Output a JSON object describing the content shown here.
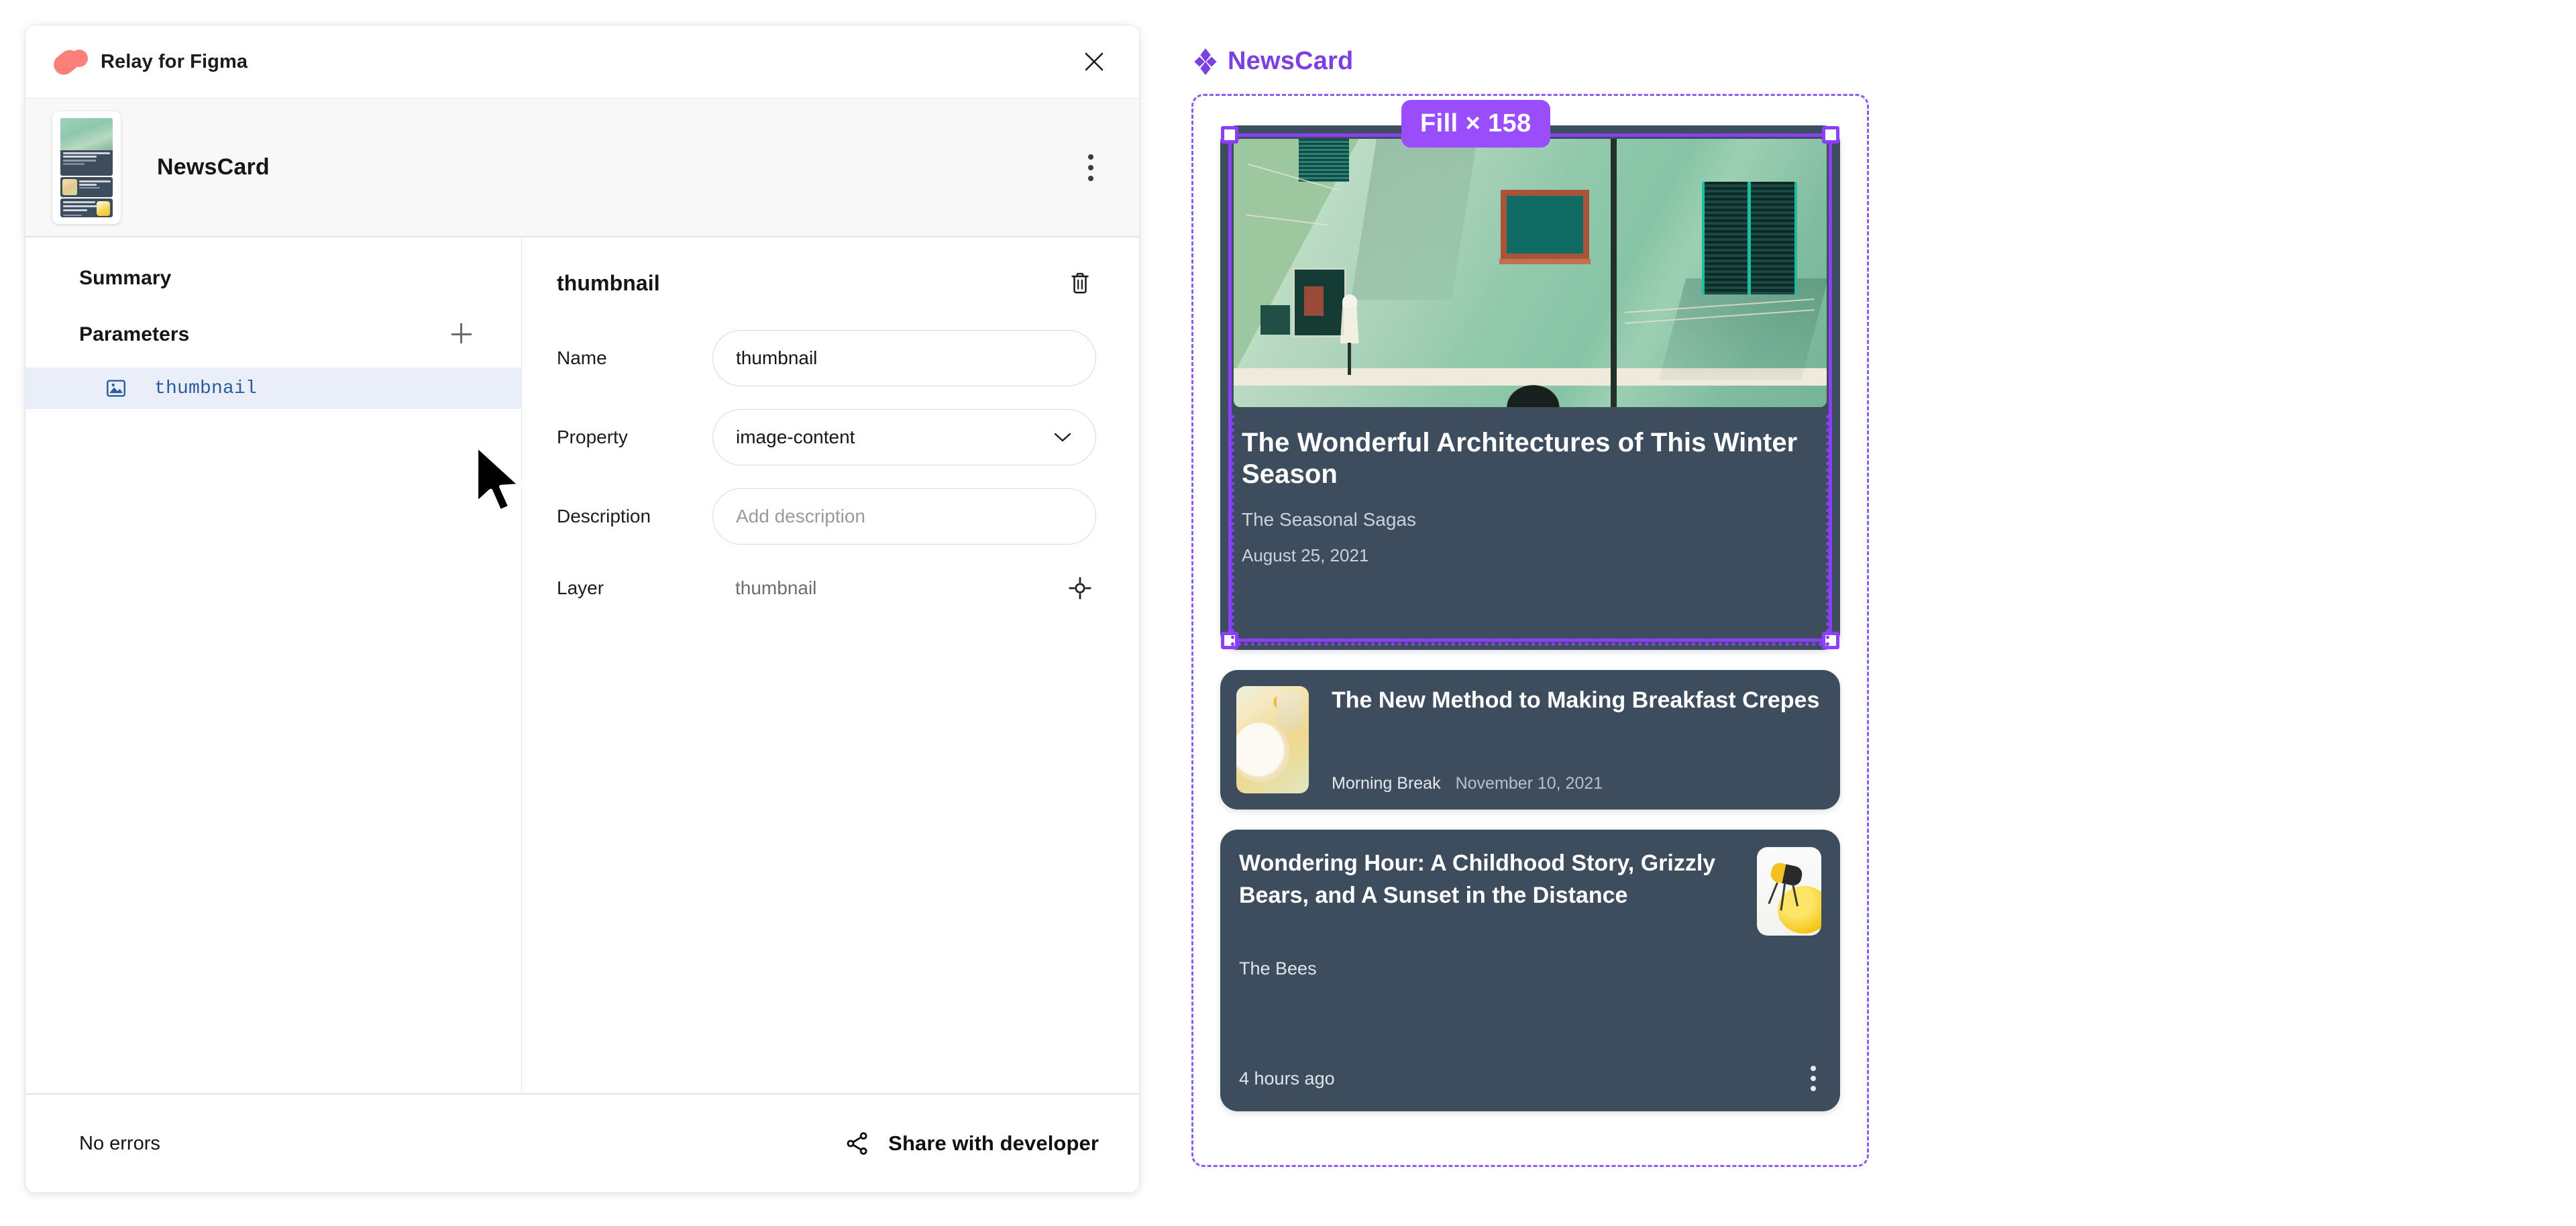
{
  "plugin": {
    "title": "Relay for Figma",
    "close_icon": "close-icon",
    "component": {
      "name": "NewsCard",
      "menu_icon": "kebab-menu-icon"
    },
    "sections": {
      "summary_label": "Summary",
      "parameters_label": "Parameters",
      "add_parameter_icon": "plus-icon"
    },
    "parameters": [
      {
        "name": "thumbnail",
        "icon": "image-icon",
        "selected": true
      }
    ],
    "detail": {
      "title": "thumbnail",
      "delete_icon": "trash-icon",
      "fields": [
        {
          "label": "Name",
          "value": "thumbnail",
          "type": "text"
        },
        {
          "label": "Property",
          "value": "image-content",
          "type": "select"
        },
        {
          "label": "Description",
          "value": "",
          "placeholder": "Add description",
          "type": "text"
        }
      ],
      "layer": {
        "label": "Layer",
        "value": "thumbnail",
        "icon": "target-icon"
      }
    },
    "footer": {
      "status": "No errors",
      "share_label": "Share with developer",
      "share_icon": "share-icon"
    }
  },
  "canvas": {
    "component_label": "NewsCard",
    "component_icon": "figma-component-diamond-icon",
    "selection_badge": "Fill × 158",
    "cards": [
      {
        "title": "The Wonderful Architectures of This Winter Season",
        "source": "The Seasonal Sagas",
        "date": "August 25, 2021",
        "image": "green-building-facade-photo",
        "selected": true
      },
      {
        "title": "The New Method to Making Breakfast Crepes",
        "source": "Morning Break",
        "date": "November 10, 2021",
        "image": "breakfast-crepes-photo"
      },
      {
        "title": "Wondering Hour: A Childhood Story, Grizzly Bears, and A Sunset in the Distance",
        "source": "The Bees",
        "date": "4 hours ago",
        "image": "bee-on-honey-drop-photo",
        "menu_icon": "kebab-menu-icon"
      }
    ]
  },
  "colors": {
    "relay_brand": "#fb8079",
    "figma_purple": "#7b3fe4",
    "selection_purple": "#8b3ffb",
    "badge_purple": "#9a4dfa",
    "card_bg": "#3e4d5e",
    "param_selected_bg": "#eaeef8",
    "param_text": "#2a5c9c"
  }
}
